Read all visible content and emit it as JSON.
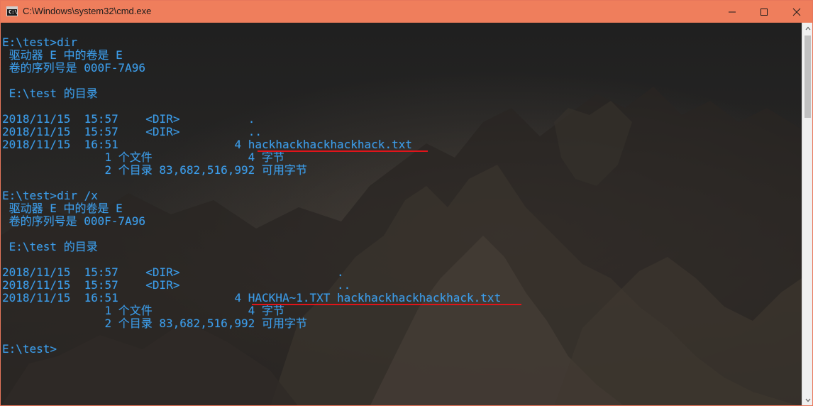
{
  "window": {
    "title": "C:\\Windows\\system32\\cmd.exe",
    "icon": "cmd-icon",
    "controls": [
      "minimize-icon",
      "maximize-icon",
      "close-icon"
    ]
  },
  "console": {
    "text_color": "#3c9ce8",
    "underline_color": "#e0141a",
    "lines": [
      "E:\\test>dir",
      " 驱动器 E 中的卷是 E",
      " 卷的序列号是 000F-7A96",
      "",
      " E:\\test 的目录",
      "",
      "2018/11/15  15:57    <DIR>          .",
      "2018/11/15  15:57    <DIR>          ..",
      "2018/11/15  16:51                 4 hackhackhackhackhack.txt",
      "               1 个文件              4 字节",
      "               2 个目录 83,682,516,992 可用字节",
      "",
      "E:\\test>dir /x",
      " 驱动器 E 中的卷是 E",
      " 卷的序列号是 000F-7A96",
      "",
      " E:\\test 的目录",
      "",
      "2018/11/15  15:57    <DIR>                       .",
      "2018/11/15  15:57    <DIR>                       ..",
      "2018/11/15  16:51                 4 HACKHA~1.TXT hackhackhackhackhack.txt",
      "               1 个文件              4 字节",
      "               2 个目录 83,682,516,992 可用字节",
      "",
      "E:\\test>"
    ]
  }
}
